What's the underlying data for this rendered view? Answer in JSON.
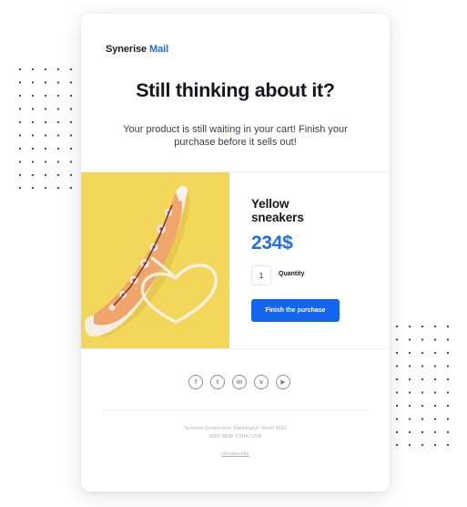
{
  "logo": {
    "brand": "Synerise",
    "accent": "Mail"
  },
  "headline": "Still thinking about it?",
  "subtext": "Your product is still waiting in your cart! Finish your purchase before it sells out!",
  "product": {
    "title_line1": "Yellow",
    "title_line2": "sneakers",
    "price": "234$",
    "quantity": "1",
    "quantity_label": "Quantity",
    "cta_label": "Finish the purchase"
  },
  "socials": [
    {
      "icon": "facebook-icon",
      "glyph": "f"
    },
    {
      "icon": "twitter-icon",
      "glyph": "t"
    },
    {
      "icon": "linkedin-icon",
      "glyph": "in"
    },
    {
      "icon": "vimeo-icon",
      "glyph": "v"
    },
    {
      "icon": "youtube-icon",
      "glyph": "▶"
    }
  ],
  "footer": {
    "address_line1": "Synerise Ecommerce Washington Street 5612",
    "address_line2": "5669 NEW YORK, USA",
    "unsubscribe": "Unsubscribe"
  },
  "colors": {
    "accent": "#1a6cf5",
    "cta": "#1465f0",
    "product_bg": "#f2d75a",
    "heading": "#15171f"
  }
}
